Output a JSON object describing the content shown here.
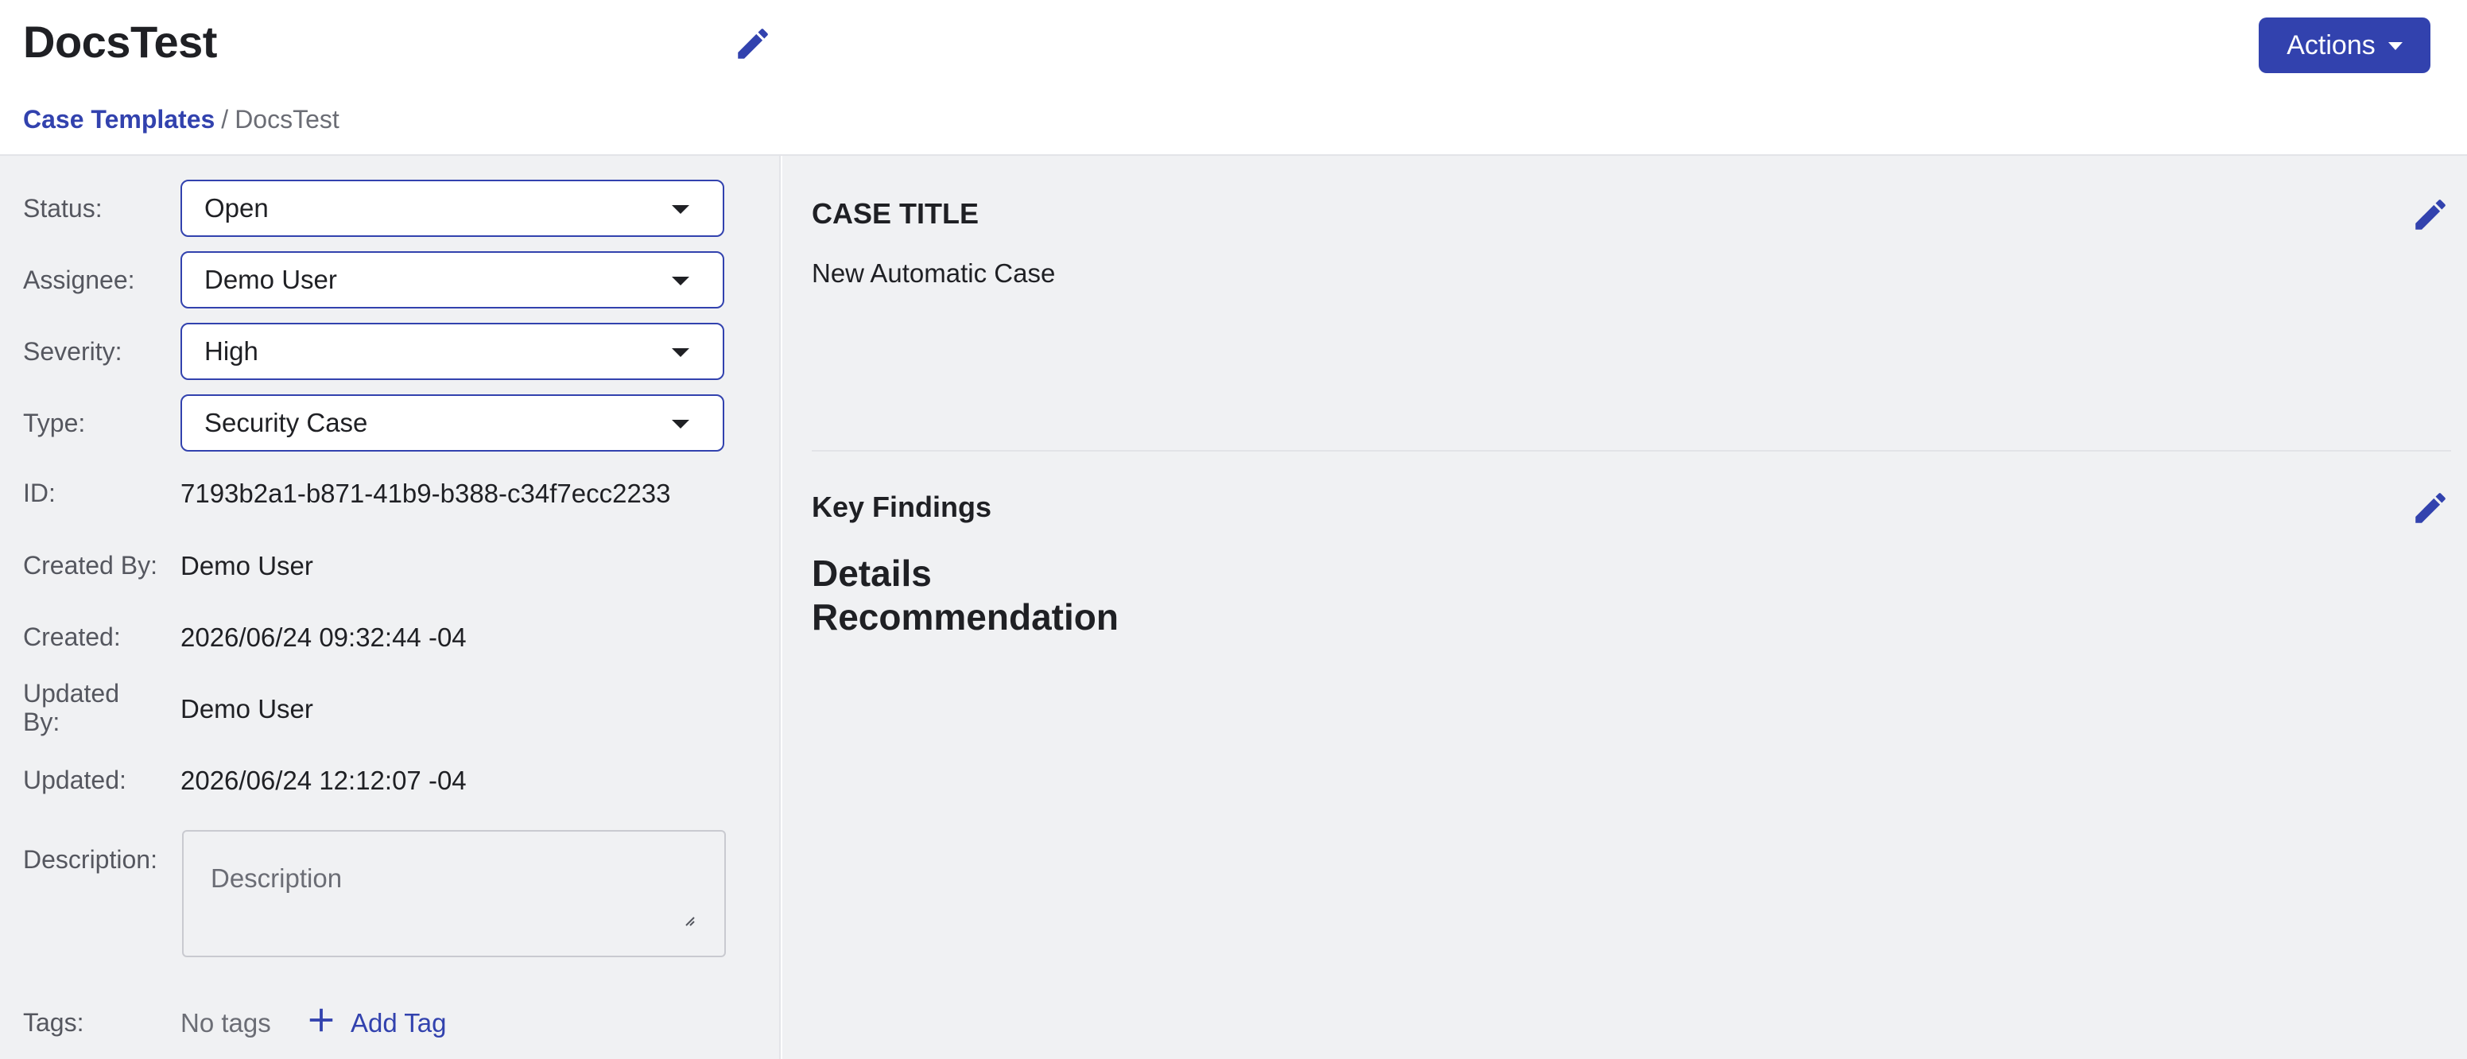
{
  "header": {
    "title": "DocsTest",
    "actions_label": "Actions",
    "breadcrumb": {
      "parent": "Case Templates",
      "separator": "/",
      "current": "DocsTest"
    }
  },
  "fields": {
    "status": {
      "label": "Status:",
      "value": "Open"
    },
    "assignee": {
      "label": "Assignee:",
      "value": "Demo User"
    },
    "severity": {
      "label": "Severity:",
      "value": "High"
    },
    "type": {
      "label": "Type:",
      "value": "Security Case"
    },
    "id": {
      "label": "ID:",
      "value": "7193b2a1-b871-41b9-b388-c34f7ecc2233"
    },
    "created_by": {
      "label": "Created By:",
      "value": "Demo User"
    },
    "created": {
      "label": "Created:",
      "value": "2026/06/24 09:32:44 -04"
    },
    "updated_by": {
      "label_line1": "Updated",
      "label_line2": "By:",
      "value": "Demo User"
    },
    "updated": {
      "label": "Updated:",
      "value": "2026/06/24 12:12:07 -04"
    },
    "description": {
      "label": "Description:",
      "placeholder": "Description"
    },
    "tags": {
      "label": "Tags:",
      "empty_text": "No tags",
      "add_label": "Add Tag"
    }
  },
  "main": {
    "case_title": {
      "heading": "CASE TITLE",
      "value": "New Automatic Case"
    },
    "key_findings": {
      "heading": "Key Findings",
      "lines": [
        "Details",
        "Recommendation"
      ]
    }
  },
  "icons": {
    "edit": "pencil-icon",
    "add": "plus-icon",
    "dropdown": "caret-down-icon"
  },
  "colors": {
    "accent": "#3242ae",
    "panel_bg": "#f0f1f3",
    "text": "#1f2024",
    "muted_text": "#55575f"
  }
}
